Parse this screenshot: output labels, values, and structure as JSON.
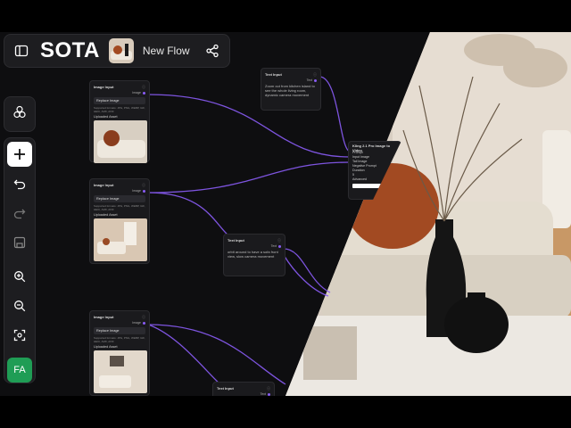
{
  "app": {
    "logo": "SOTA",
    "flow_title": "New Flow"
  },
  "icons": {
    "sidebar_toggle": "sidebar-toggle-icon",
    "share": "share-icon",
    "nodes": "nodes-icon",
    "add": "plus-icon",
    "undo": "undo-icon",
    "redo": "redo-icon",
    "save": "save-icon",
    "zoom_in": "zoom-in-icon",
    "zoom_out": "zoom-out-icon",
    "fit": "fit-view-icon"
  },
  "user": {
    "initials": "FA"
  },
  "colors": {
    "edge": "#8a5cf6",
    "avatar": "#1f9d55"
  },
  "nodes": [
    {
      "title": "Image Input",
      "output": "Image",
      "button": "Replace Image",
      "formats": "Supported formats: JPG, PNG, WEBP, GIF, HEIC, AVIF, AVIF",
      "uploaded": "Uploaded Asset"
    },
    {
      "title": "Image Input",
      "output": "Image",
      "button": "Replace Image",
      "formats": "Supported formats: JPG, PNG, WEBP, GIF, HEIC, AVIF, AVIF",
      "uploaded": "Uploaded Asset"
    },
    {
      "title": "Image Input",
      "output": "Image",
      "button": "Replace Image",
      "formats": "Supported formats: JPG, PNG, WEBP, GIF, HEIC, AVIF, AVIF",
      "uploaded": "Uploaded Asset"
    }
  ],
  "text_nodes": [
    {
      "title": "Text Input",
      "output": "Text",
      "body": "Zoom out from kitchen island to see the whole living room, dynamic camera movement"
    },
    {
      "title": "Text Input",
      "output": "Text",
      "body": "orbit around to have a sofa front view, slow camera movement"
    },
    {
      "title": "Text Input",
      "output": "Text"
    }
  ],
  "gen_node": {
    "title": "Kling 2.1 Pro Image to Video",
    "inputs": [
      "Prompt",
      "Input Image",
      "Tail Image",
      "Negative Prompt"
    ],
    "duration_label": "Duration",
    "duration_value": "5",
    "advanced": "Advanced"
  }
}
